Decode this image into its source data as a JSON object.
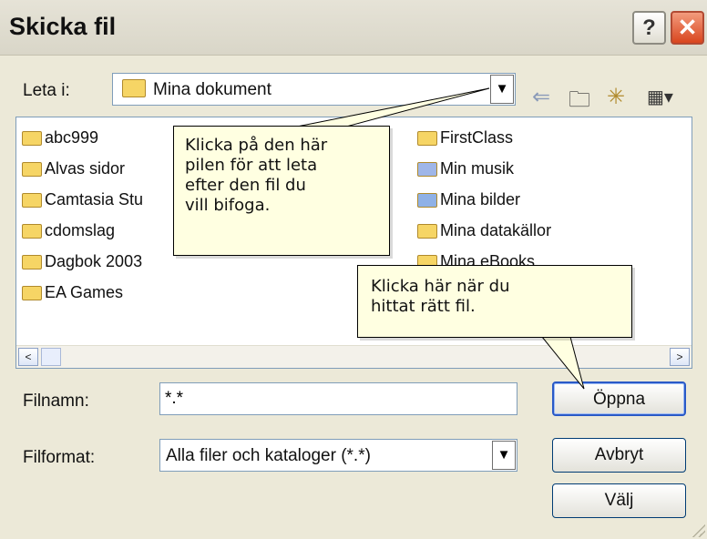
{
  "window": {
    "title": "Skicka fil"
  },
  "title_buttons": {
    "help": "?",
    "close": "✕"
  },
  "lookin": {
    "label": "Leta i:",
    "value": "Mina dokument"
  },
  "toolbar": {
    "back_glyph": "⇐",
    "up_glyph": "🗀",
    "newfolder_glyph": "✳",
    "views_glyph": "▦▾"
  },
  "files": [
    {
      "name": "abc999",
      "icon": "folder-icon"
    },
    {
      "name": "Alvas sidor",
      "icon": "folder-icon"
    },
    {
      "name": "Camtasia Stu",
      "icon": "folder-icon"
    },
    {
      "name": "cdomslag",
      "icon": "folder-icon"
    },
    {
      "name": "Dagbok 2003",
      "icon": "folder-icon"
    },
    {
      "name": "EA Games",
      "icon": "folder-icon"
    },
    {
      "name": "FirstClass",
      "icon": "folder-icon"
    },
    {
      "name": "Min musik",
      "icon": "music-folder-icon"
    },
    {
      "name": "Mina bilder",
      "icon": "pictures-folder-icon"
    },
    {
      "name": "Mina datakällor",
      "icon": "datasource-folder-icon"
    },
    {
      "name": "Mina eBooks",
      "icon": "folder-icon"
    }
  ],
  "scroll": {
    "left": "<",
    "right": ">"
  },
  "filename": {
    "label": "Filnamn:",
    "value": "*.*"
  },
  "filetype": {
    "label": "Filformat:",
    "value": "Alla filer och kataloger (*.*)"
  },
  "buttons": {
    "open": "Öppna",
    "cancel": "Avbryt",
    "select": "Välj"
  },
  "callouts": {
    "dropdown_hint": "Klicka på den här\npilen för att leta\nefter den fil du\nvill bifoga.",
    "open_hint": "Klicka här när du\nhittat rätt fil."
  },
  "colors": {
    "title_close": "#D9451E",
    "callout_bg": "#FFFFE1",
    "dialog_bg": "#ECE9D8"
  }
}
